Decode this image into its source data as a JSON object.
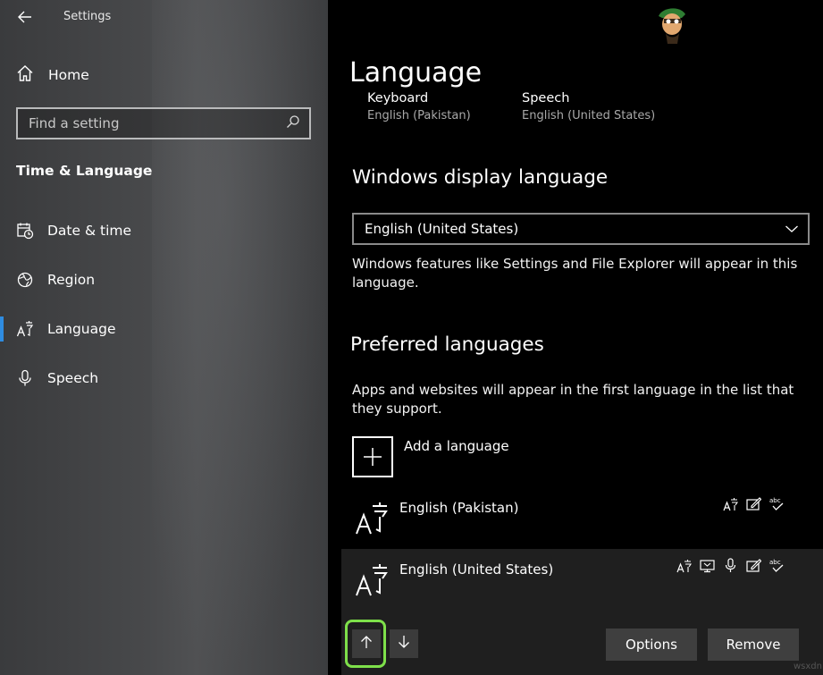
{
  "sidebar": {
    "app_title": "Settings",
    "home_label": "Home",
    "search_placeholder": "Find a setting",
    "section_title": "Time & Language",
    "items": [
      {
        "label": "Date & time",
        "icon": "calendar-clock-icon"
      },
      {
        "label": "Region",
        "icon": "globe-icon"
      },
      {
        "label": "Language",
        "icon": "language-icon",
        "selected": true
      },
      {
        "label": "Speech",
        "icon": "microphone-icon"
      }
    ]
  },
  "main": {
    "page_title": "Language",
    "top_items": [
      {
        "title": "Keyboard",
        "subtitle": "English (Pakistan)"
      },
      {
        "title": "Speech",
        "subtitle": "English (United States)"
      }
    ],
    "display_language": {
      "heading": "Windows display language",
      "selected_value": "English (United States)",
      "description": "Windows features like Settings and File Explorer will appear in this language."
    },
    "preferred": {
      "heading": "Preferred languages",
      "description": "Apps and websites will appear in the first language in the list that they support.",
      "add_label": "Add a language",
      "languages": [
        {
          "name": "English (Pakistan)",
          "features": [
            "text-to-speech-icon",
            "handwriting-icon",
            "spellcheck-icon"
          ]
        },
        {
          "name": "English (United States)",
          "features": [
            "text-to-speech-icon",
            "display-language-icon",
            "speech-recognition-icon",
            "handwriting-icon",
            "spellcheck-icon"
          ],
          "selected": true
        }
      ],
      "options_label": "Options",
      "remove_label": "Remove"
    },
    "watermark": "wsxdn.com"
  },
  "colors": {
    "accent": "#2f8ce0",
    "highlight": "#7ee04a",
    "background": "#000000"
  }
}
